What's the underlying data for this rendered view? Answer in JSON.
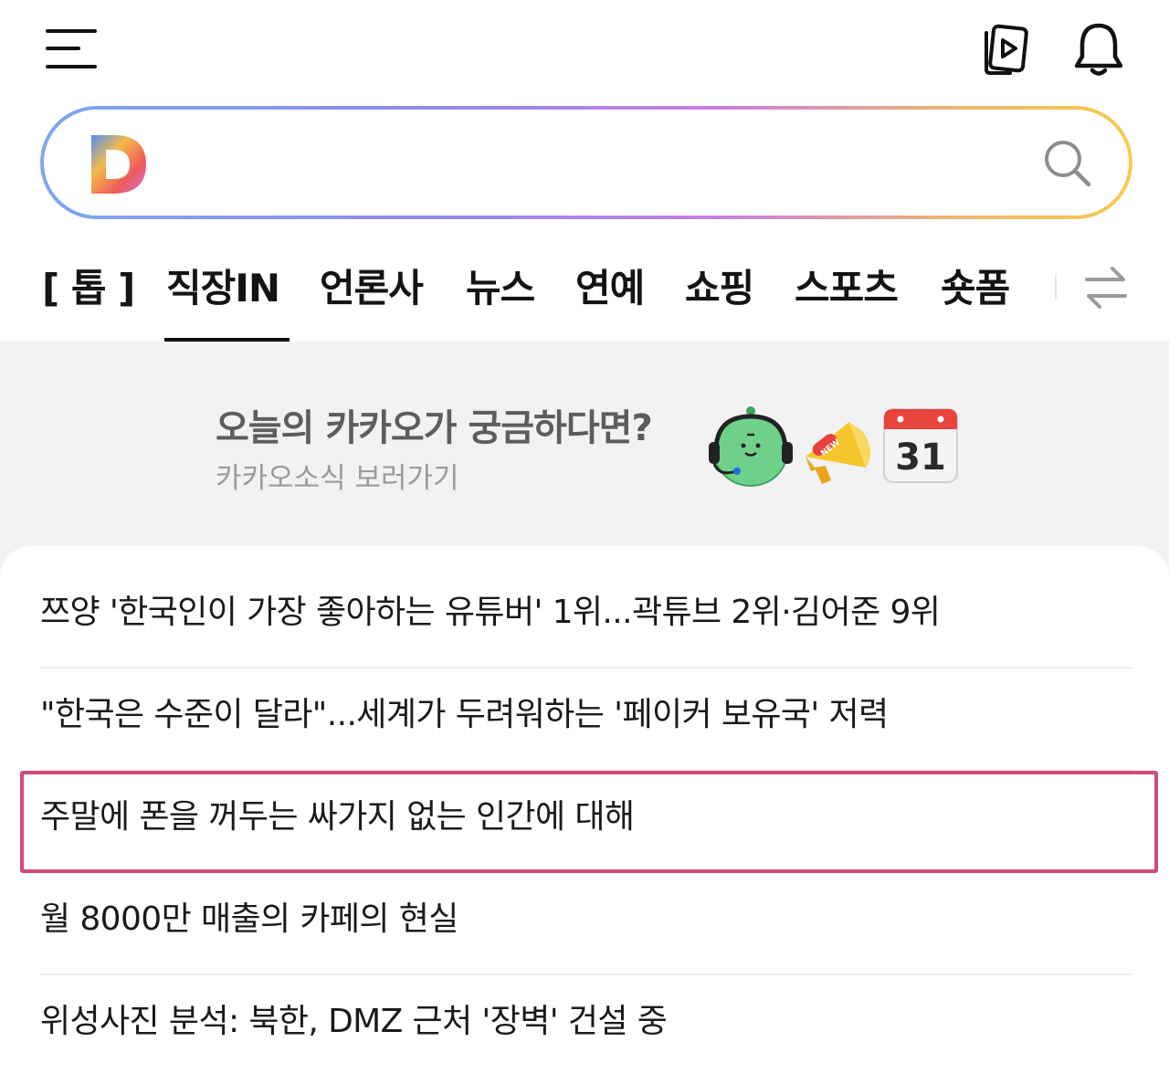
{
  "header": {
    "menu_icon": "hamburger-menu-icon",
    "video_icon": "video-play-icon",
    "bell_icon": "bell-icon"
  },
  "search": {
    "logo_text": "D",
    "logo_icon": "daum-logo-icon",
    "placeholder": "",
    "value": "",
    "search_icon": "search-icon",
    "gradient_colors": [
      "#7fa7ef",
      "#c77fe2",
      "#f6cc4e"
    ]
  },
  "tabs": {
    "items": [
      {
        "label": "[ 톱 ]"
      },
      {
        "label": "직장IN"
      },
      {
        "label": "언론사"
      },
      {
        "label": "뉴스"
      },
      {
        "label": "연예"
      },
      {
        "label": "쇼핑"
      },
      {
        "label": "스포츠"
      },
      {
        "label": "숏폼"
      }
    ],
    "active_index": 1,
    "swap_icon": "swap-arrows-icon"
  },
  "banner": {
    "title": "오늘의 카카오가 궁금하다면?",
    "subtitle": "카카오소식 보러가기",
    "calendar_day": "31",
    "megaphone_badge": "NEW",
    "icons": [
      "character-headset-icon",
      "megaphone-icon",
      "calendar-icon"
    ]
  },
  "news": {
    "items": [
      {
        "title": "쯔양 '한국인이 가장 좋아하는 유튜버' 1위...곽튜브 2위·김어준 9위"
      },
      {
        "title": "\"한국은 수준이 달라\"...세계가 두려워하는 '페이커 보유국' 저력"
      },
      {
        "title": "주말에 폰을 꺼두는 싸가지 없는 인간에 대해"
      },
      {
        "title": "월 8000만 매출의 카페의 현실"
      },
      {
        "title": "위성사진 분석: 북한, DMZ 근처 '장벽' 건설 중"
      }
    ],
    "highlighted_index": 2,
    "highlight_color": "#d4487a"
  }
}
